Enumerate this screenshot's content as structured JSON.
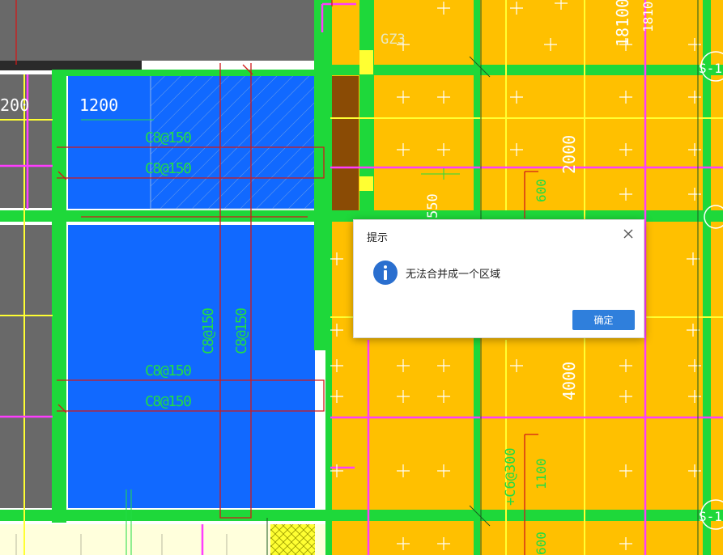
{
  "drawing": {
    "labels": {
      "gz3": "GZ3",
      "dim_1200_a": "200",
      "dim_1200_b": "1200",
      "rebar_1": "C8@150",
      "rebar_2": "C8@150",
      "rebar_3": "C8@150",
      "rebar_4": "C8@150",
      "rebar_v1": "C8@150",
      "rebar_v2": "C8@150",
      "dim_18100": "18100",
      "dim_1810": "1810",
      "dim_2000": "2000",
      "dim_550": "550",
      "dim_600_a": "600",
      "dim_4000": "4000",
      "dim_c6": "+C6@300",
      "dim_1100": "1100",
      "dim_600_b": "600",
      "axis_s1_top": "S-1",
      "axis_s1_bottom": "S-1"
    },
    "colors": {
      "slab_orange": "#ffc000",
      "slab_blue": "#1169ff",
      "beam_green": "#1ed83a",
      "column_gray": "#696969",
      "magenta_line": "#ff3cff",
      "yellow_line": "#ffff32",
      "red_line": "#d01a1a",
      "text_green": "#22dd44"
    }
  },
  "dialog": {
    "title": "提示",
    "close_icon": "close-icon",
    "info_icon": "info-icon",
    "message": "无法合并成一个区域",
    "ok_label": "确定"
  }
}
